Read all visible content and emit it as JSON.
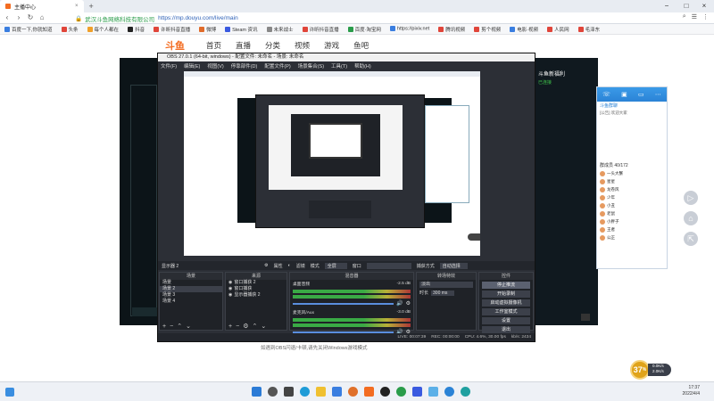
{
  "browser": {
    "tab_title": "主播中心",
    "url": "https://mp.douyu.com/live/main",
    "site_label": "武汉斗鱼网络科技有限公司",
    "bookmarks": [
      "百度一下,你就知道",
      "头条",
      "每个人都在",
      "抖音",
      "许昕抖音直播",
      "微博",
      "Steam 资讯",
      "未来战士",
      "许昕抖音直播",
      "百度·淘宝网",
      "https://pixiv.net",
      "腾讯视频",
      "剪个视频",
      "电影·视频",
      "人民网",
      "毛泽东"
    ]
  },
  "douyu": {
    "logo": "斗鱼",
    "nav": [
      "首页",
      "直播",
      "分类",
      "视频",
      "游戏",
      "鱼吧"
    ],
    "footer_text": "如遇到OBS闪退/卡顿,请先关闭Windows游戏模式"
  },
  "obs": {
    "title": "OBS 27.0.1 (64-bit, windows) - 配置文件: 未命名 - 场景: 未命名",
    "menu": [
      "文件(F)",
      "编辑(E)",
      "视图(V)",
      "停靠部件(D)",
      "配置文件(P)",
      "场景集合(S)",
      "工具(T)",
      "帮助(H)"
    ],
    "ctrlbar": {
      "scene_label": "显示器 2",
      "props": "属性",
      "filters": "滤镜",
      "mode_label": "模式",
      "mode_value": "全屏",
      "window_label": "窗口",
      "capture_label": "捕获方式",
      "capture_value": "自动选择"
    },
    "docks": {
      "scenes": {
        "title": "场景",
        "items": [
          "场景",
          "场景 2",
          "场景 3",
          "场景 4"
        ],
        "selected_index": 1
      },
      "sources": {
        "title": "来源",
        "items": [
          "窗口捕获 2",
          "窗口捕获",
          "显示器捕获 2"
        ]
      },
      "mixer": {
        "title": "混音器",
        "channels": [
          {
            "name": "桌面音频",
            "level": "-2.5 dB"
          },
          {
            "name": "麦克风/Aux",
            "level": "-3.0 dB"
          }
        ]
      },
      "transitions": {
        "title": "转场特效",
        "type": "淡出",
        "duration_label": "时长",
        "duration_value": "300 ms"
      },
      "controls": {
        "title": "控件",
        "buttons": [
          "停止推流",
          "开始录制",
          "启动虚拟摄像机",
          "工作室模式",
          "设置",
          "退出"
        ]
      }
    },
    "status": {
      "live": "LIVE: 00:07:39",
      "rec": "REC: 00:00:00",
      "cpu": "CPU: 4.6%, 30.00 fps",
      "kbs": "kb/s: 2434"
    }
  },
  "qq": {
    "group_name": "斗鱼群聊",
    "announcement": "[公告] 欢迎大家",
    "members_label": "群成员 40/172",
    "members": [
      "一头大蟹",
      "星星",
      "龙卷风",
      "少年",
      "小丑",
      "老鼠",
      "小胖子",
      "王者",
      "公正"
    ]
  },
  "right_panel": {
    "title": "斗鱼新福利",
    "subtitle": "已连接"
  },
  "taskbar": {
    "time": "17:37",
    "date": "2022/4/4"
  },
  "widget": {
    "cpu_percent": "37",
    "unit": "%",
    "up": "0.0K/s",
    "down": "2.0K/s"
  }
}
